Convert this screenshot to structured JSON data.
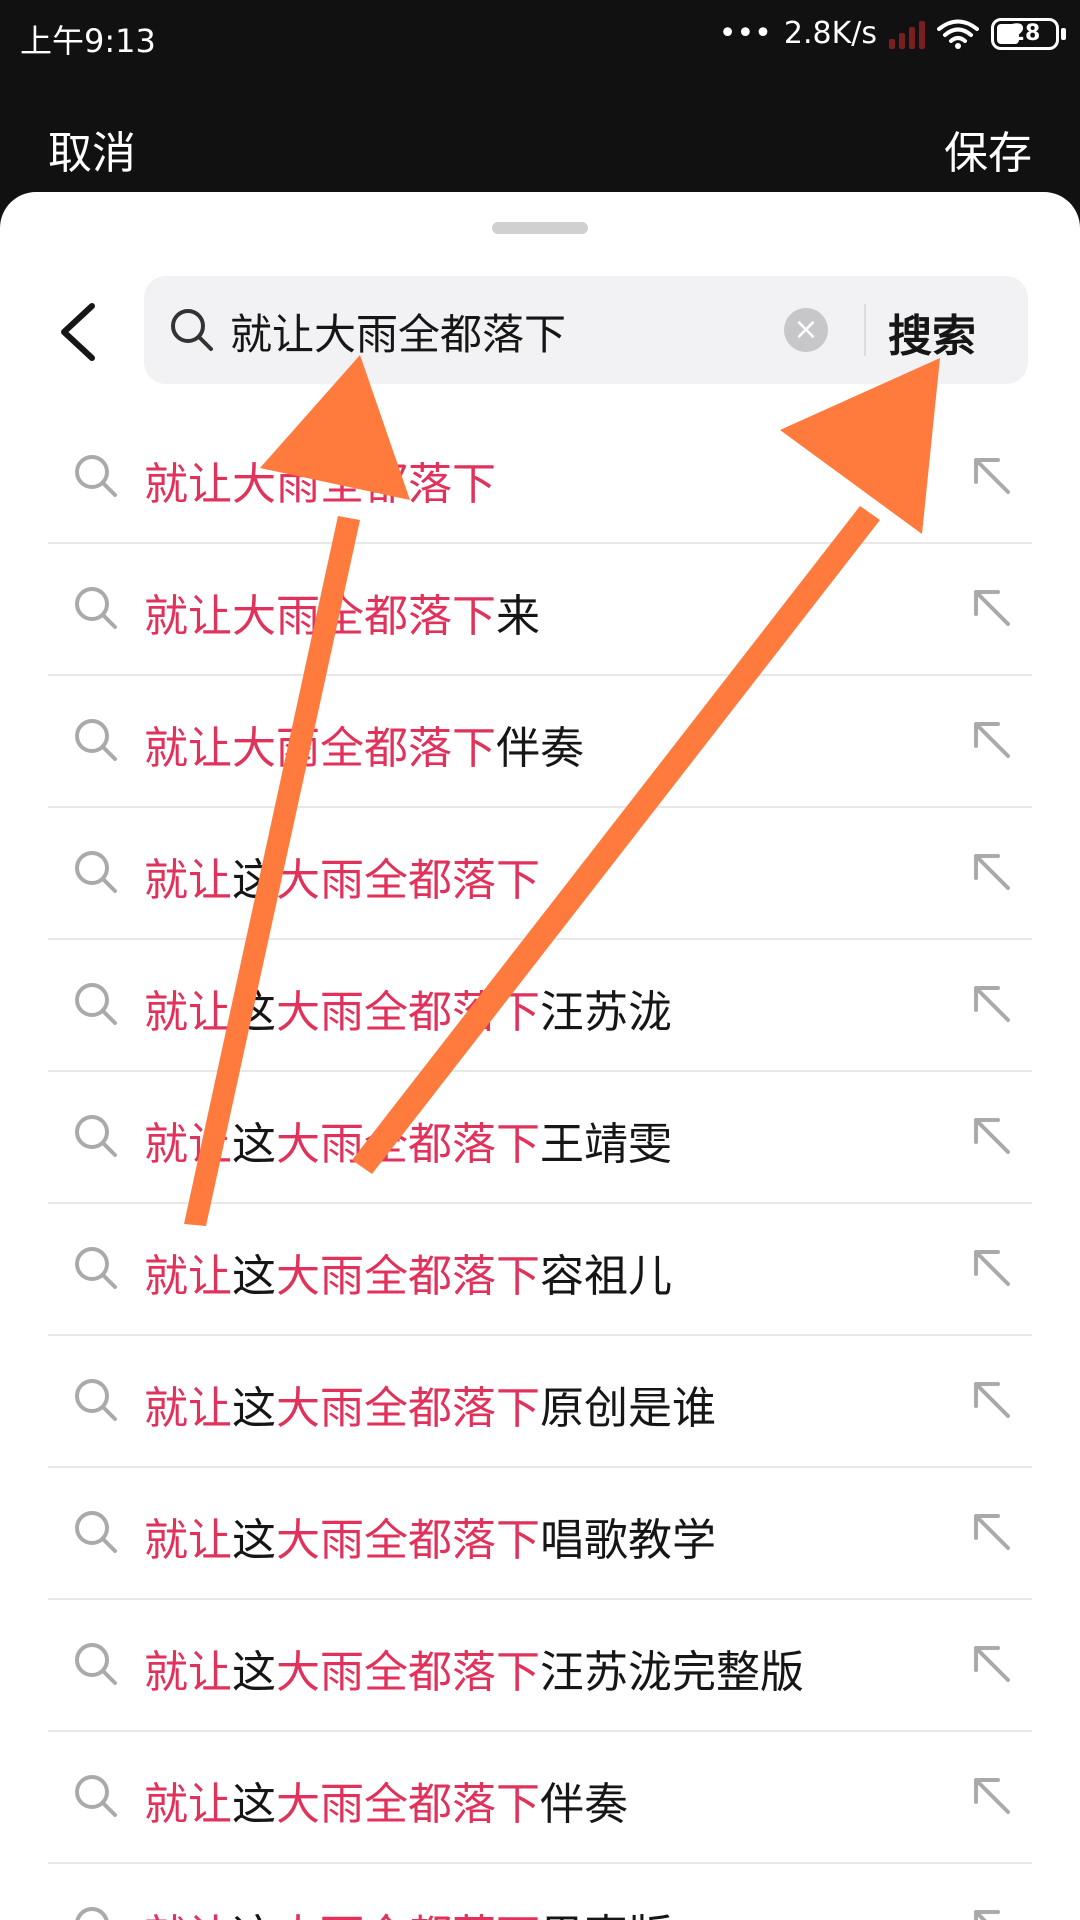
{
  "status_bar": {
    "time": "上午9:13",
    "dots": "•••",
    "net_speed": "2.8K/s",
    "battery": "28"
  },
  "top_bar": {
    "cancel_label": "取消",
    "save_label": "保存"
  },
  "search": {
    "query": "就让大雨全都落下",
    "clear_symbol": "×",
    "search_label": "搜索"
  },
  "suggestions": [
    [
      {
        "t": "就让大雨全都落下",
        "hl": true
      }
    ],
    [
      {
        "t": "就让大雨全都落下",
        "hl": true
      },
      {
        "t": "来",
        "hl": false
      }
    ],
    [
      {
        "t": "就让大雨全都落下",
        "hl": true
      },
      {
        "t": "伴奏",
        "hl": false
      }
    ],
    [
      {
        "t": "就让",
        "hl": true
      },
      {
        "t": "这",
        "hl": false
      },
      {
        "t": "大雨全都落下",
        "hl": true
      }
    ],
    [
      {
        "t": "就让",
        "hl": true
      },
      {
        "t": "这",
        "hl": false
      },
      {
        "t": "大雨全都落下",
        "hl": true
      },
      {
        "t": "汪苏泷",
        "hl": false
      }
    ],
    [
      {
        "t": "就让",
        "hl": true
      },
      {
        "t": "这",
        "hl": false
      },
      {
        "t": "大雨全都落下",
        "hl": true
      },
      {
        "t": "王靖雯",
        "hl": false
      }
    ],
    [
      {
        "t": "就让",
        "hl": true
      },
      {
        "t": "这",
        "hl": false
      },
      {
        "t": "大雨全都落下",
        "hl": true
      },
      {
        "t": "容祖儿",
        "hl": false
      }
    ],
    [
      {
        "t": "就让",
        "hl": true
      },
      {
        "t": "这",
        "hl": false
      },
      {
        "t": "大雨全都落下",
        "hl": true
      },
      {
        "t": "原创是谁",
        "hl": false
      }
    ],
    [
      {
        "t": "就让",
        "hl": true
      },
      {
        "t": "这",
        "hl": false
      },
      {
        "t": "大雨全都落下",
        "hl": true
      },
      {
        "t": "唱歌教学",
        "hl": false
      }
    ],
    [
      {
        "t": "就让",
        "hl": true
      },
      {
        "t": "这",
        "hl": false
      },
      {
        "t": "大雨全都落下",
        "hl": true
      },
      {
        "t": "汪苏泷完整版",
        "hl": false
      }
    ],
    [
      {
        "t": "就让",
        "hl": true
      },
      {
        "t": "这",
        "hl": false
      },
      {
        "t": "大雨全都落下",
        "hl": true
      },
      {
        "t": "伴奏",
        "hl": false
      }
    ],
    [
      {
        "t": "就让",
        "hl": true
      },
      {
        "t": "这",
        "hl": false
      },
      {
        "t": "大雨全都落下",
        "hl": true
      },
      {
        "t": "男声版",
        "hl": false
      }
    ]
  ],
  "colors": {
    "highlight": "#e0325b",
    "annotation_arrow": "#ff7a3d",
    "status_bg": "#111111"
  },
  "icons": {
    "back": "chevron-left-icon",
    "search": "search-icon",
    "clear": "clear-icon",
    "fill": "arrow-up-left-icon"
  }
}
